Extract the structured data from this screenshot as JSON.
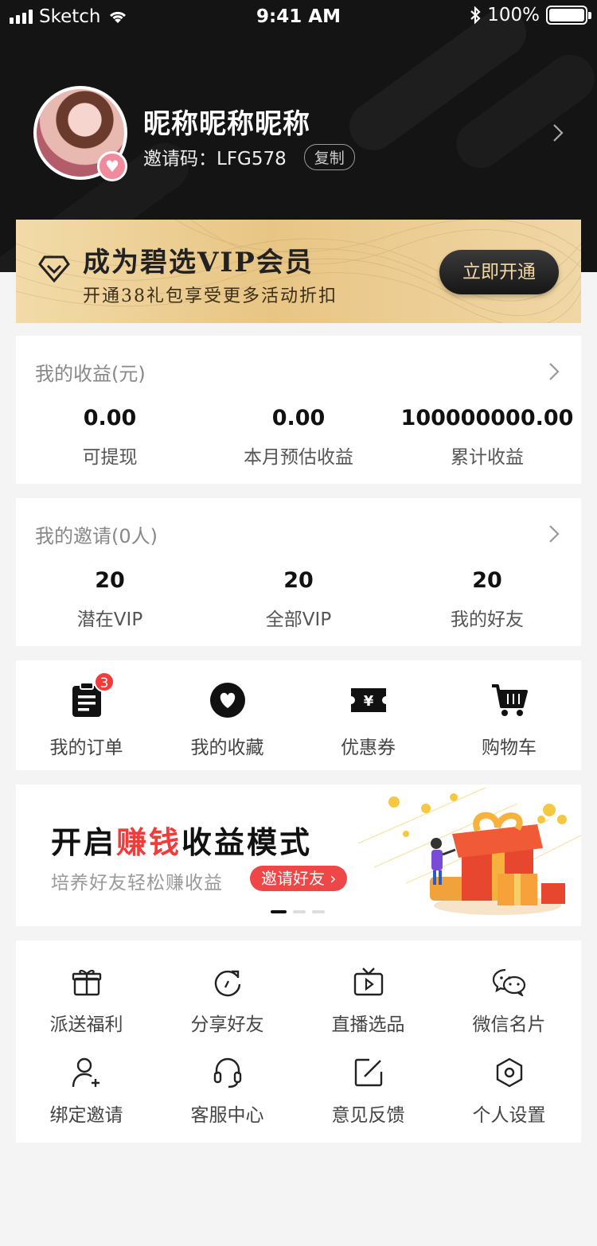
{
  "status_bar": {
    "carrier": "Sketch",
    "time": "9:41 AM",
    "battery": "100%"
  },
  "profile": {
    "nickname": "昵称昵称昵称",
    "invite_label": "邀请码：LFG578",
    "copy_label": "复制"
  },
  "vip": {
    "title": "成为碧选VIP会员",
    "subtitle": "开通38礼包享受更多活动折扣",
    "button": "立即开通"
  },
  "earnings": {
    "title": "我的收益(元)",
    "items": [
      {
        "value": "0.00",
        "label": "可提现"
      },
      {
        "value": "0.00",
        "label": "本月预估收益"
      },
      {
        "value": "100000000.00",
        "label": "累计收益"
      }
    ]
  },
  "invites": {
    "title": "我的邀请(0人)",
    "items": [
      {
        "value": "20",
        "label": "潜在VIP"
      },
      {
        "value": "20",
        "label": "全部VIP"
      },
      {
        "value": "20",
        "label": "我的好友"
      }
    ]
  },
  "shortcuts": [
    {
      "label": "我的订单",
      "icon": "order-icon",
      "badge": "3"
    },
    {
      "label": "我的收藏",
      "icon": "heart-icon"
    },
    {
      "label": "优惠券",
      "icon": "coupon-icon"
    },
    {
      "label": "购物车",
      "icon": "cart-icon"
    }
  ],
  "promo": {
    "title_a": "开启",
    "title_hl": "赚钱",
    "title_b": "收益模式",
    "subtitle": "培养好友轻松赚收益",
    "button": "邀请好友 ›",
    "pages": 3,
    "active_page": 1
  },
  "services": [
    {
      "label": "派送福利",
      "icon": "gift-icon"
    },
    {
      "label": "分享好友",
      "icon": "share-icon"
    },
    {
      "label": "直播选品",
      "icon": "tv-icon"
    },
    {
      "label": "微信名片",
      "icon": "wechat-icon"
    },
    {
      "label": "绑定邀请",
      "icon": "add-user-icon"
    },
    {
      "label": "客服中心",
      "icon": "headset-icon"
    },
    {
      "label": "意见反馈",
      "icon": "edit-icon"
    },
    {
      "label": "个人设置",
      "icon": "settings-icon"
    }
  ]
}
